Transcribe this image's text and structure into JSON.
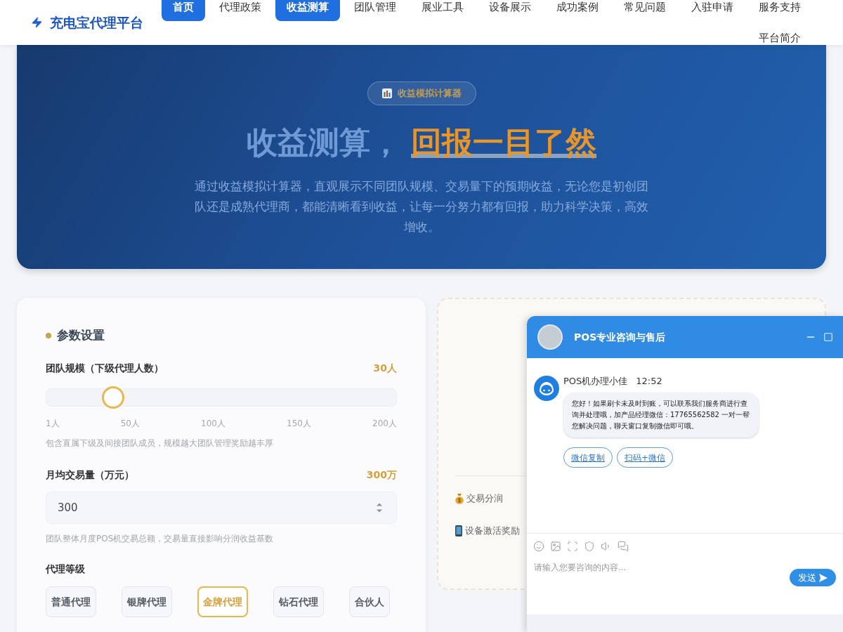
{
  "header": {
    "logo": "充电宝代理平台",
    "nav": [
      {
        "label": "首页",
        "selected": true
      },
      {
        "label": "代理政策",
        "selected": false
      },
      {
        "label": "收益测算",
        "selected": true
      },
      {
        "label": "团队管理",
        "selected": false
      },
      {
        "label": "展业工具",
        "selected": false
      },
      {
        "label": "设备展示",
        "selected": false
      },
      {
        "label": "成功案例",
        "selected": false
      },
      {
        "label": "常见问题",
        "selected": false
      },
      {
        "label": "入驻申请",
        "selected": false
      },
      {
        "label": "服务支持",
        "selected": false
      },
      {
        "label": "平台简介",
        "selected": false
      }
    ]
  },
  "hero": {
    "badge": "收益模拟计算器",
    "title": "收益测算，",
    "title_highlight": "回报一目了然",
    "description": "通过收益模拟计算器，直观展示不同团队规模、交易量下的预期收益，无论您是初创团队还是成熟代理商，都能清晰看到收益，让每一分努力都有回报，助力科学决策，高效增收。"
  },
  "settings": {
    "title": "参数设置",
    "team_size": {
      "label": "团队规模（下级代理人数）",
      "value": "30人",
      "level": 0.17,
      "ticks": [
        "1人",
        "50人",
        "100人",
        "150人",
        "200人"
      ],
      "hint": "包含直属下级及间接团队成员，规模越大团队管理奖励越丰厚"
    },
    "volume": {
      "label": "月均交易量（万元）",
      "value": "300万",
      "input": "300",
      "hint": "团队整体月度POS机交易总额，交易量直接影响分润收益基数"
    },
    "tier": {
      "label": "代理等级",
      "options": [
        {
          "label": "普通代理",
          "selected": false
        },
        {
          "label": "银牌代理",
          "selected": false
        },
        {
          "label": "金牌代理",
          "selected": true
        },
        {
          "label": "钻石代理",
          "selected": false
        },
        {
          "label": "合伙人",
          "selected": false
        }
      ]
    }
  },
  "income": {
    "items": [
      {
        "kind": "commission",
        "label": "交易分润"
      },
      {
        "kind": "activation",
        "label": "设备激活奖励"
      }
    ]
  },
  "chat": {
    "title": "POS专业咨询与售后",
    "sender": "POS机办理小佳",
    "time": "12:52",
    "message": "您好！如果刷卡未及时到账，可以联系我们服务商进行查询并处理哦，加产品经理微信：17765562582 一对一帮您解决问题，聊天窗口复制微信即可哦。",
    "actions": [
      "微信复制",
      "扫码+微信"
    ],
    "placeholder": "请输入您要咨询的内容...",
    "send": "发送"
  }
}
